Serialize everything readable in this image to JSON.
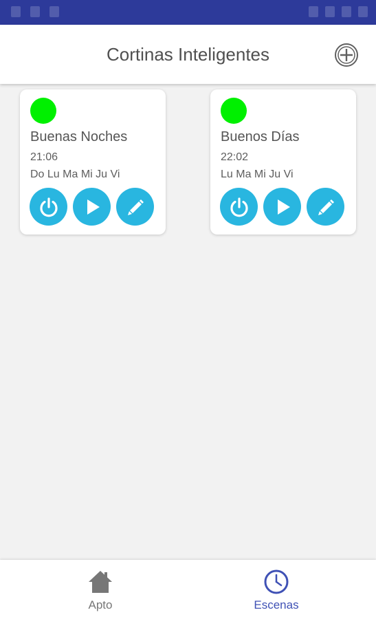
{
  "header": {
    "title": "Cortinas Inteligentes",
    "add_icon": "add-circle-icon"
  },
  "scenes": [
    {
      "name": "Buenas Noches",
      "time": "21:06",
      "days": "Do Lu Ma Mi Ju Vi",
      "status_color": "#00f000",
      "buttons": [
        "power-icon",
        "play-icon",
        "pencil-icon"
      ]
    },
    {
      "name": "Buenos Días",
      "time": "22:02",
      "days": "Lu Ma Mi Ju Vi",
      "status_color": "#00f000",
      "buttons": [
        "power-icon",
        "play-icon",
        "pencil-icon"
      ]
    }
  ],
  "bottom_nav": {
    "items": [
      {
        "label": "Apto",
        "icon": "home-icon",
        "active": false
      },
      {
        "label": "Escenas",
        "icon": "clock-icon",
        "active": true
      }
    ]
  },
  "colors": {
    "status_bar": "#2d3a9a",
    "accent_button": "#29b6e0",
    "active_nav": "#3f51b5",
    "inactive_nav": "#777777",
    "status_active": "#00f000"
  }
}
